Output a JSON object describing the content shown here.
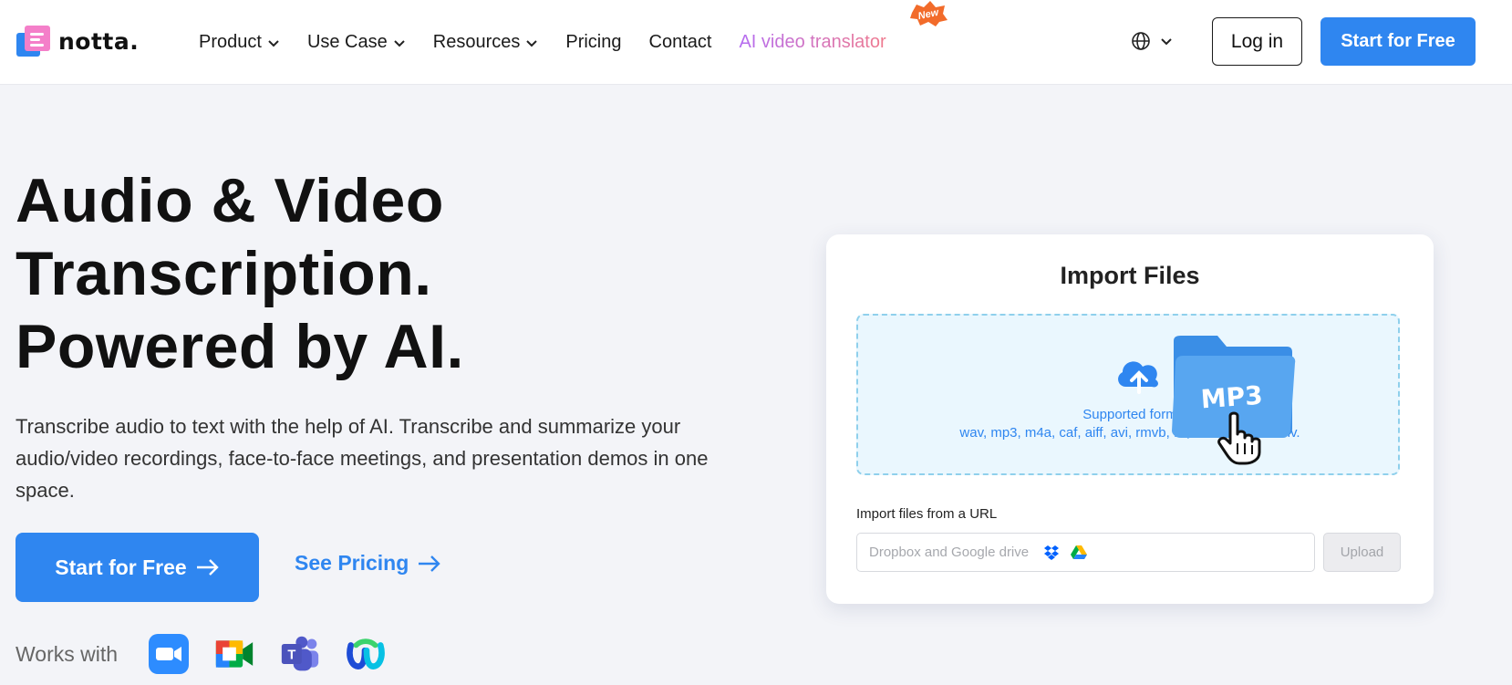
{
  "header": {
    "logo_text": "notta.",
    "nav": [
      {
        "label": "Product",
        "has_dropdown": true
      },
      {
        "label": "Use Case",
        "has_dropdown": true
      },
      {
        "label": "Resources",
        "has_dropdown": true
      },
      {
        "label": "Pricing",
        "has_dropdown": false
      },
      {
        "label": "Contact",
        "has_dropdown": false
      },
      {
        "label": "AI video translator",
        "has_dropdown": false
      }
    ],
    "new_badge": "New",
    "language_icon": "globe-icon",
    "login_label": "Log in",
    "start_label": "Start for Free"
  },
  "hero": {
    "title_lines": [
      "Audio & Video",
      "Transcription.",
      "Powered by AI."
    ],
    "description": "Transcribe audio to text with the help of AI. Transcribe and summarize your audio/video recordings, face-to-face meetings, and presentation demos in one space.",
    "cta_primary": "Start for Free",
    "cta_secondary": "See Pricing",
    "works_with_label": "Works with",
    "integrations": [
      "zoom-icon",
      "google-meet-icon",
      "microsoft-teams-icon",
      "webex-icon"
    ]
  },
  "import_card": {
    "title": "Import Files",
    "supported_label": "Supported form",
    "formats_text": "wav, mp3, m4a, caf, aiff, avi, rmvb, flv, m",
    "formats_tail": "wmv.",
    "folder_label": "MP3",
    "url_label": "Import files from a URL",
    "url_placeholder": "Dropbox and Google drive",
    "upload_label": "Upload"
  },
  "colors": {
    "accent": "#2f86f0",
    "background": "#f3f4f8",
    "dropzone_bg": "#eaf7fe",
    "dropzone_border": "#8fd0ec",
    "ai_gradient_start": "#b46cf2",
    "ai_gradient_end": "#f07a8d",
    "new_badge": "#f26b2a"
  }
}
